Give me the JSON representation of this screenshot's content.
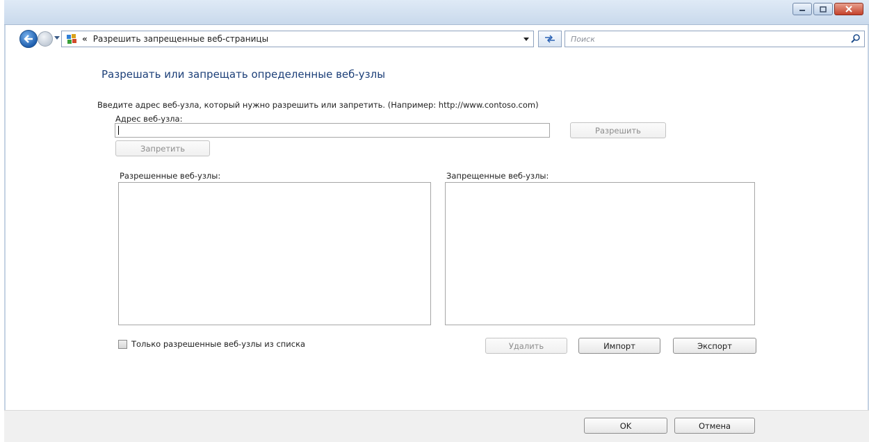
{
  "nav": {
    "breadcrumb_chevron": "«",
    "address_text": "Разрешить запрещенные веб-страницы",
    "search_placeholder": "Поиск"
  },
  "page": {
    "title": "Разрешать или запрещать определенные веб-узлы",
    "instruction": "Введите адрес веб-узла, который нужно разрешить или запретить. (Например: http://www.contoso.com)",
    "address_label": "Адрес веб-узла:",
    "address_value": "",
    "allow_label": "Разрешить",
    "block_label": "Запретить",
    "allowed_list_label": "Разрешенные веб-узлы:",
    "blocked_list_label": "Запрещенные веб-узлы:",
    "allowed_sites": [],
    "blocked_sites": [],
    "only_allowed_label": "Только разрешенные веб-узлы из списка",
    "only_allowed_checked": false,
    "delete_label": "Удалить",
    "import_label": "Импорт",
    "export_label": "Экспорт"
  },
  "footer": {
    "ok_label": "OK",
    "cancel_label": "Отмена"
  },
  "icons": {
    "back": "back-arrow-icon",
    "forward": "forward-arrow-icon",
    "control_panel": "control-panel-icon",
    "refresh": "refresh-icon",
    "search": "search-icon",
    "minimize": "minimize-icon",
    "maximize": "maximize-icon",
    "close": "close-icon"
  },
  "colors": {
    "title_text": "#1c3f78",
    "titlebar": "#c9d9ec",
    "close_button": "#c4422b"
  }
}
